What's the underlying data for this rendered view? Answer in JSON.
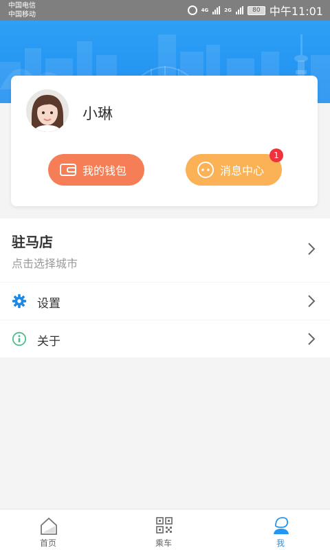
{
  "status_bar": {
    "carrier1": "中国电信",
    "carrier2": "中国移动",
    "signal1": "4G",
    "signal2": "2G",
    "battery": "80",
    "time": "中午11:01"
  },
  "profile": {
    "username": "小琳",
    "wallet_label": "我的钱包",
    "message_label": "消息中心",
    "message_badge": "1"
  },
  "city": {
    "name": "驻马店",
    "hint": "点击选择城市"
  },
  "menu": [
    {
      "label": "设置",
      "icon": "gear-icon"
    },
    {
      "label": "关于",
      "icon": "info-icon"
    }
  ],
  "bottom_nav": [
    {
      "label": "首页",
      "icon": "home-icon",
      "active": false
    },
    {
      "label": "乘车",
      "icon": "qr-code-icon",
      "active": false
    },
    {
      "label": "我",
      "icon": "user-icon",
      "active": true
    }
  ],
  "colors": {
    "header_blue": "#1f8ff0",
    "wallet_orange": "#f57e56",
    "message_orange": "#fbb257",
    "badge_red": "#f0323c",
    "active_blue": "#2196f3",
    "settings_blue": "#1e88e5",
    "about_green": "#4bc08a"
  }
}
